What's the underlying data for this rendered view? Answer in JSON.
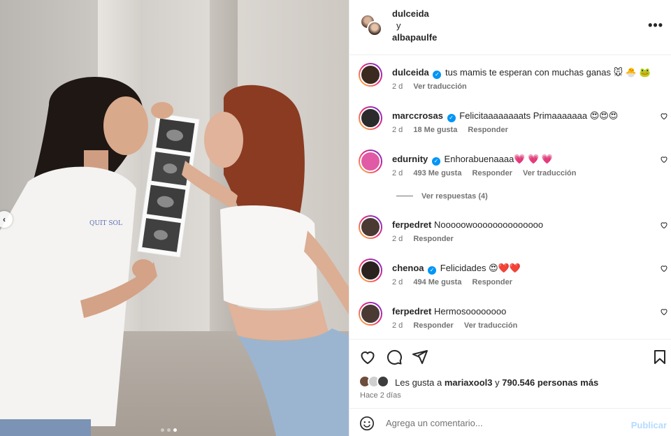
{
  "header": {
    "user1": "dulceida",
    "conjunction": "y",
    "user2": "albapaulfe",
    "more_label": "•••"
  },
  "comments": [
    {
      "user": "dulceida",
      "verified": true,
      "text": "tus mamis te esperan con muchas ganas 🐭 🐣 🐸",
      "time": "2 d",
      "likes": "",
      "reply": "",
      "translate": "Ver traducción",
      "avatar_color": "#3b2a20",
      "has_heart": false
    },
    {
      "user": "marccrosas",
      "verified": true,
      "text": "Felicitaaaaaaaats Primaaaaaaa 😍😍😍",
      "time": "2 d",
      "likes": "18 Me gusta",
      "reply": "Responder",
      "translate": "",
      "avatar_color": "#2b2b2b",
      "has_heart": true
    },
    {
      "user": "edurnity",
      "verified": true,
      "text": "Enhorabuenaaaa💗 💗 💗",
      "time": "2 d",
      "likes": "493 Me gusta",
      "reply": "Responder",
      "translate": "Ver traducción",
      "avatar_color": "#e05aa5",
      "has_heart": true
    },
    {
      "user": "ferpedret",
      "verified": false,
      "text": "Nooooowoooooooooooooo",
      "time": "2 d",
      "likes": "",
      "reply": "Responder",
      "translate": "",
      "avatar_color": "#4a3a33",
      "has_heart": true
    },
    {
      "user": "chenoa",
      "verified": true,
      "text": "Felicidades 😍❤️❤️",
      "time": "2 d",
      "likes": "494 Me gusta",
      "reply": "Responder",
      "translate": "",
      "avatar_color": "#2a221e",
      "has_heart": true
    },
    {
      "user": "ferpedret",
      "verified": false,
      "text": "Hermosoooooooo",
      "time": "2 d",
      "likes": "",
      "reply": "Responder",
      "translate": "Ver traducción",
      "avatar_color": "#4a3a33",
      "has_heart": true
    }
  ],
  "view_replies": "Ver respuestas (4)",
  "likes_summary": {
    "prefix": "Les gusta a",
    "user": "mariaxool3",
    "connector": "y",
    "count": "790.546 personas más"
  },
  "post_time": "Hace 2 días",
  "comment_box": {
    "placeholder": "Agrega un comentario...",
    "publish_label": "Publicar"
  },
  "colors": {
    "verified": "#0095f6",
    "publish_disabled": "#b3dbff",
    "meta_text": "#737373",
    "border": "#efefef"
  },
  "carousel": {
    "slides": 3,
    "active_index": 2
  }
}
